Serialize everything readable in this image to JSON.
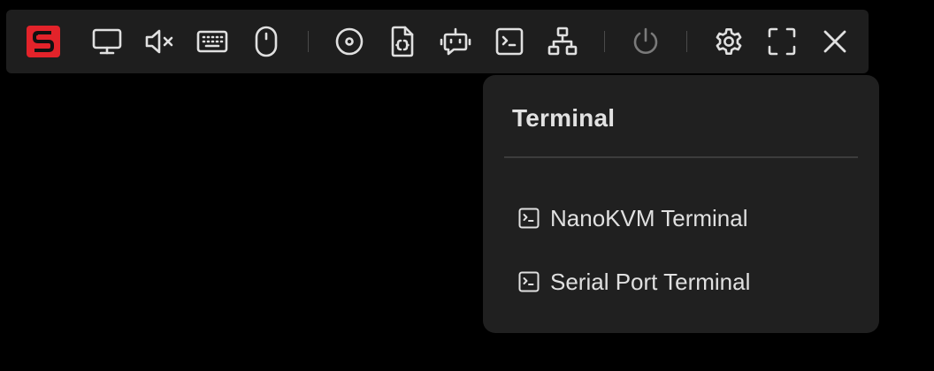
{
  "toolbar": {
    "logo": {
      "icon": "sipeed-logo-icon",
      "letter": "S",
      "color": "#e3232a"
    },
    "items": [
      {
        "name": "screen",
        "icon": "monitor-icon"
      },
      {
        "name": "audio",
        "icon": "speaker-muted-icon"
      },
      {
        "name": "keyboard",
        "icon": "keyboard-icon"
      },
      {
        "name": "mouse",
        "icon": "mouse-icon"
      },
      {
        "name": "virtual-media",
        "icon": "disc-icon"
      },
      {
        "name": "script",
        "icon": "file-code-icon"
      },
      {
        "name": "bot",
        "icon": "bot-icon"
      },
      {
        "name": "terminal",
        "icon": "terminal-icon"
      },
      {
        "name": "network",
        "icon": "network-icon"
      },
      {
        "name": "power",
        "icon": "power-icon",
        "state": "disabled"
      },
      {
        "name": "settings",
        "icon": "gear-icon"
      },
      {
        "name": "fullscreen",
        "icon": "fullscreen-icon"
      },
      {
        "name": "close",
        "icon": "close-icon"
      }
    ]
  },
  "popover": {
    "title": "Terminal",
    "items": [
      {
        "label": "NanoKVM Terminal",
        "icon": "terminal-icon"
      },
      {
        "label": "Serial Port Terminal",
        "icon": "terminal-icon"
      }
    ]
  },
  "colors": {
    "background": "#000000",
    "toolbar": "#1e1e1e",
    "popover": "#202020",
    "icon": "#e0e0e0",
    "icon_disabled": "#7a7a7a",
    "accent": "#e3232a"
  }
}
